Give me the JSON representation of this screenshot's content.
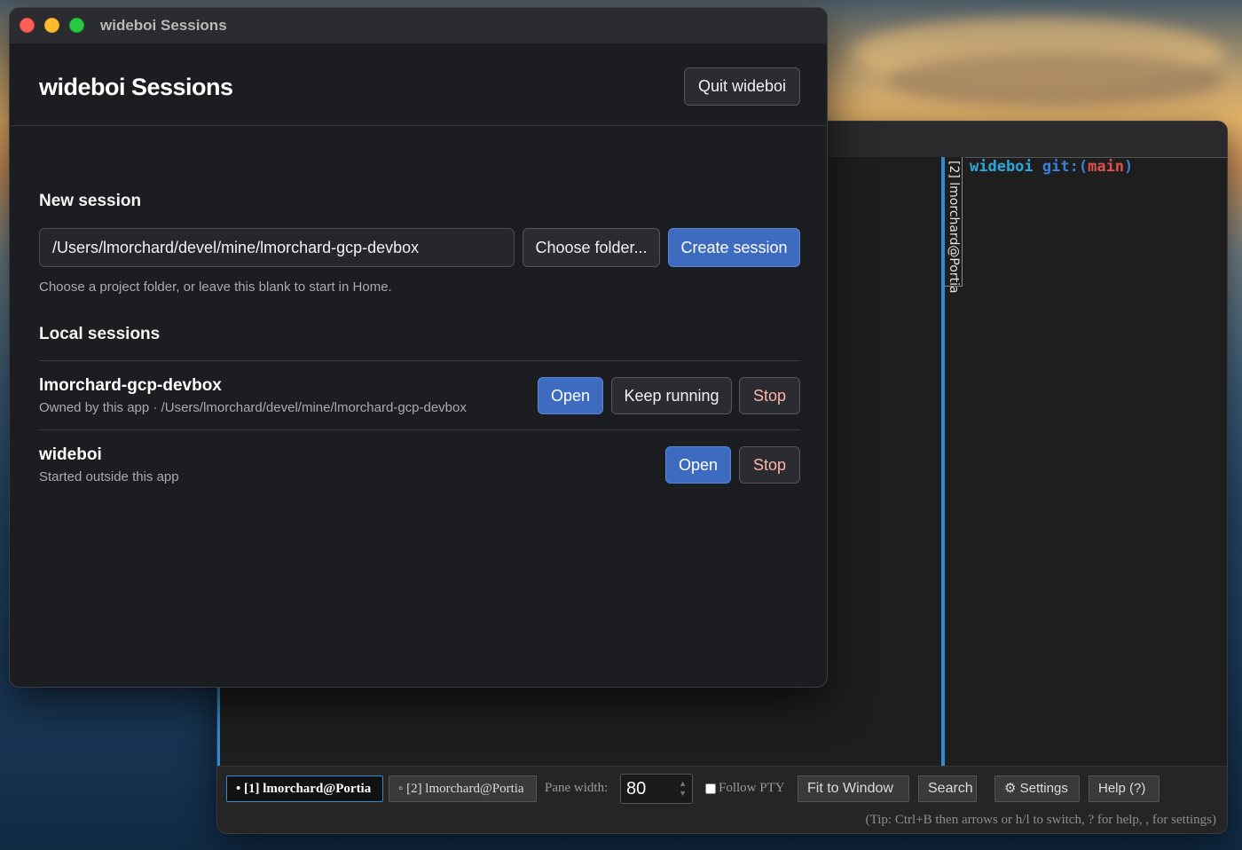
{
  "sessions_window": {
    "window_title": "wideboi Sessions",
    "heading": "wideboi Sessions",
    "quit_label": "Quit wideboi",
    "new_session": {
      "title": "New session",
      "path_value": "/Users/lmorchard/devel/mine/lmorchard-gcp-devbox",
      "choose_folder_label": "Choose folder...",
      "create_label": "Create session",
      "hint": "Choose a project folder, or leave this blank to start in Home."
    },
    "local_sessions": {
      "title": "Local sessions",
      "items": [
        {
          "name": "lmorchard-gcp-devbox",
          "subtitle": "Owned by this app · /Users/lmorchard/devel/mine/lmorchard-gcp-devbox",
          "open_label": "Open",
          "keep_running_label": "Keep running",
          "stop_label": "Stop"
        },
        {
          "name": "wideboi",
          "subtitle": "Started outside this app",
          "open_label": "Open",
          "stop_label": "Stop"
        }
      ]
    }
  },
  "terminal_window": {
    "pane_tab_label": "[2] lmorchard@Portia",
    "prompt": {
      "dir": "wideboi",
      "git": "git:(",
      "branch": "main",
      "close": ")"
    },
    "toolbar": {
      "tab1_label": "• [1] lmorchard@Portia",
      "tab2_label": "◦ [2] lmorchard@Portia",
      "pane_width_label": "Pane width:",
      "pane_width_value": "80",
      "follow_pty_label": "Follow PTY",
      "fit_label": "Fit to Window",
      "search_label": "Search",
      "settings_label": "⚙ Settings",
      "help_label": "Help (?)"
    },
    "tip": "(Tip: Ctrl+B then arrows or h/l to switch, ? for help, , for settings)"
  },
  "colors": {
    "accent_blue": "#3d6bbf",
    "pane_border": "#2f8ad8",
    "stop_text": "#ffb3ab"
  }
}
